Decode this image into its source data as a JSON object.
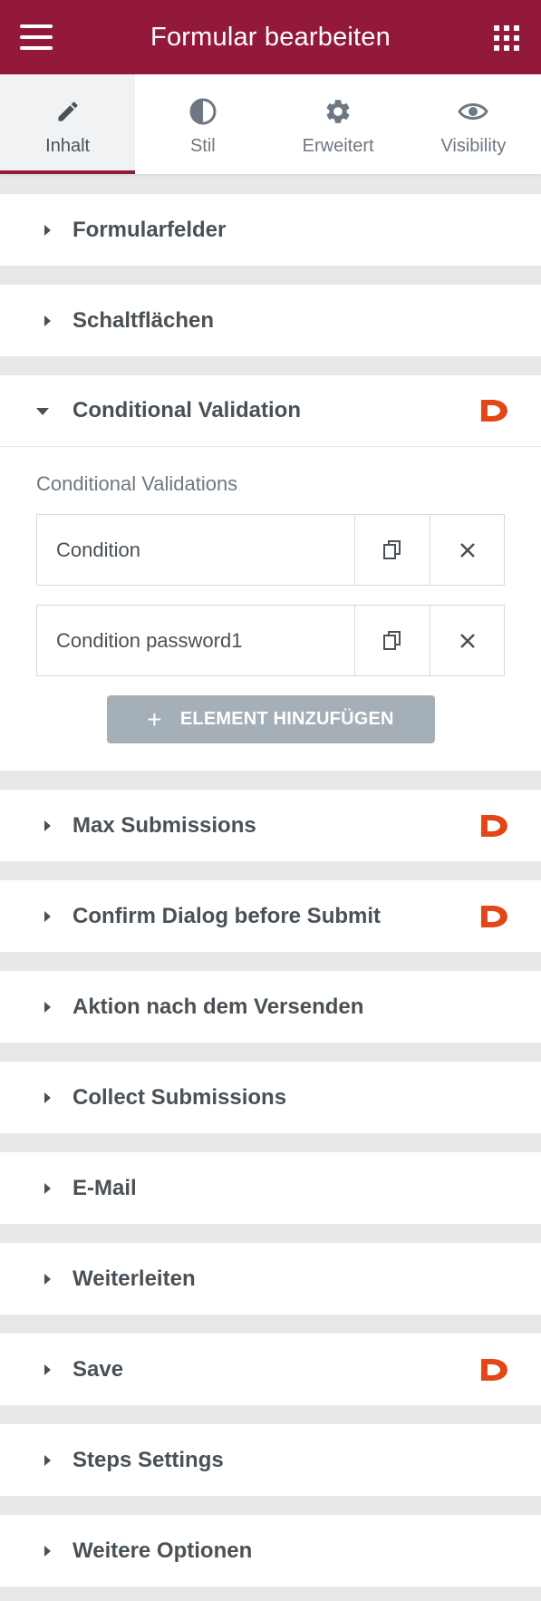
{
  "header": {
    "title": "Formular bearbeiten",
    "menu_icon": "hamburger-icon",
    "apps_icon": "grid-icon"
  },
  "tabs": [
    {
      "label": "Inhalt",
      "icon": "pencil-icon",
      "active": true
    },
    {
      "label": "Stil",
      "icon": "contrast-icon",
      "active": false
    },
    {
      "label": "Erweitert",
      "icon": "gear-icon",
      "active": false
    },
    {
      "label": "Visibility",
      "icon": "eye-icon",
      "active": false
    }
  ],
  "sections": {
    "formularfelder": "Formularfelder",
    "schaltflaechen": "Schaltflächen",
    "conditional_validation": "Conditional Validation",
    "max_submissions": "Max Submissions",
    "confirm_dialog": "Confirm Dialog before Submit",
    "aktion": "Aktion nach dem Versenden",
    "collect": "Collect Submissions",
    "email": "E-Mail",
    "weiterleiten": "Weiterleiten",
    "save": "Save",
    "steps": "Steps Settings",
    "weitere": "Weitere Optionen"
  },
  "conditional_validation": {
    "repeater_label": "Conditional Validations",
    "items": [
      {
        "title": "Condition"
      },
      {
        "title": "Condition password1"
      }
    ],
    "add_button": {
      "icon": "+",
      "label": "ELEMENT HINZUFÜGEN"
    }
  },
  "colors": {
    "brand": "#93193a",
    "dynamic_logo": "#e34719",
    "add_button": "#a4afb7"
  }
}
